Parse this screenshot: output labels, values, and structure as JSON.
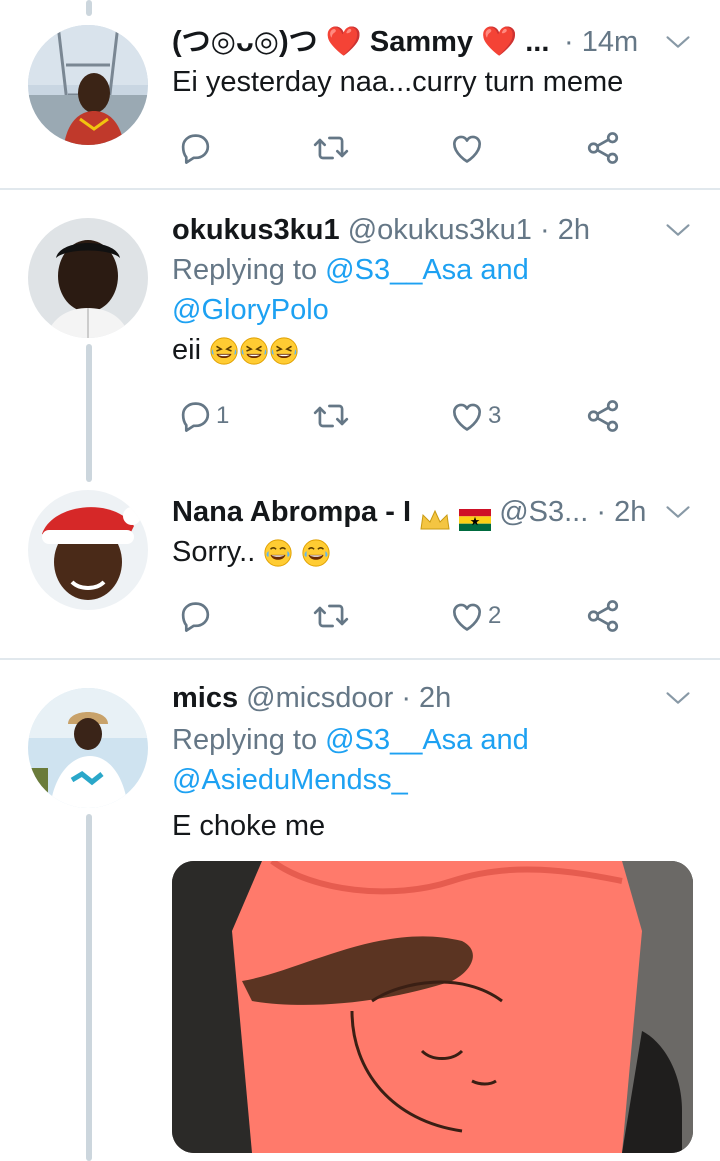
{
  "tweets": [
    {
      "name": "(つ◎ᴗ◎)つ ❤️ Sammy ❤️ ...",
      "handle": "",
      "time": "· 14m",
      "text": "Ei yesterday naa...curry turn meme",
      "reply_count": "",
      "like_count": ""
    },
    {
      "name": "okukus3ku1",
      "handle": "@okukus3ku1",
      "time": "· 2h",
      "replying_prefix": "Replying to",
      "replying_1": "@S3__Asa and",
      "replying_2": "@GloryPolo",
      "text": "eii",
      "reply_count": "1",
      "like_count": "3"
    },
    {
      "name": "Nana Abrompa - I",
      "handle": "@S3...",
      "time": "· 2h",
      "text": "Sorry..",
      "reply_count": "",
      "like_count": "2"
    },
    {
      "name": "mics",
      "handle": "@micsdoor",
      "time": "· 2h",
      "replying_prefix": "Replying to",
      "replying_1": "@S3__Asa and",
      "replying_2": "@AsieduMendss_",
      "text": "E choke me",
      "reply_count": "",
      "like_count": ""
    }
  ],
  "colors": {
    "accent": "#1da1f2",
    "secondary_text": "#657786",
    "icon": "#657786",
    "divider": "#e1e8ed",
    "thread_line": "#ccd6dd"
  },
  "icons": [
    "reply-icon",
    "retweet-icon",
    "like-icon",
    "share-icon",
    "caret-down-icon"
  ]
}
